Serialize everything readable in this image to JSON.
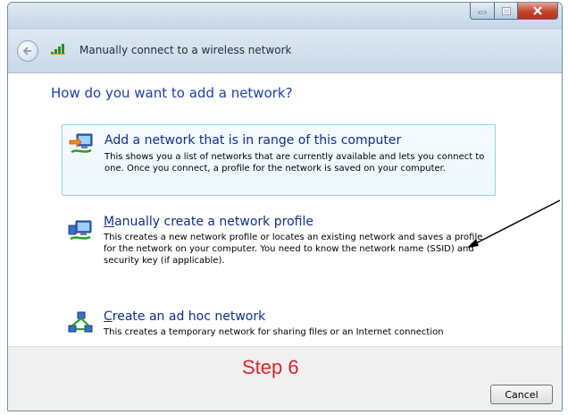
{
  "header": {
    "title": "Manually connect to a wireless network"
  },
  "main": {
    "question": "How do you want to add a network?",
    "options": [
      {
        "title": "Add a network that is in range of this computer",
        "description": "This shows you a list of networks that are currently available and lets you connect to one. Once you connect, a profile for the network is saved on your computer.",
        "icon": "network-computer-icon"
      },
      {
        "title_accel": "M",
        "title_rest": "anually create a network profile",
        "description": "This creates a new network profile or locates an existing network and saves a profile for the network on your computer. You need to know the network name (SSID) and security key (if applicable).",
        "icon": "network-computer-icon"
      },
      {
        "title_accel": "C",
        "title_rest": "reate an ad hoc network",
        "description": "This creates a temporary network for sharing files or an Internet connection",
        "icon": "adhoc-network-icon"
      }
    ]
  },
  "annotation": {
    "step_label": "Step 6"
  },
  "footer": {
    "cancel_label": "Cancel"
  },
  "colors": {
    "link_blue": "#0f2e8a",
    "question_blue": "#1e3ea8",
    "annotation_red": "#d8242a",
    "close_red": "#c6442c"
  }
}
